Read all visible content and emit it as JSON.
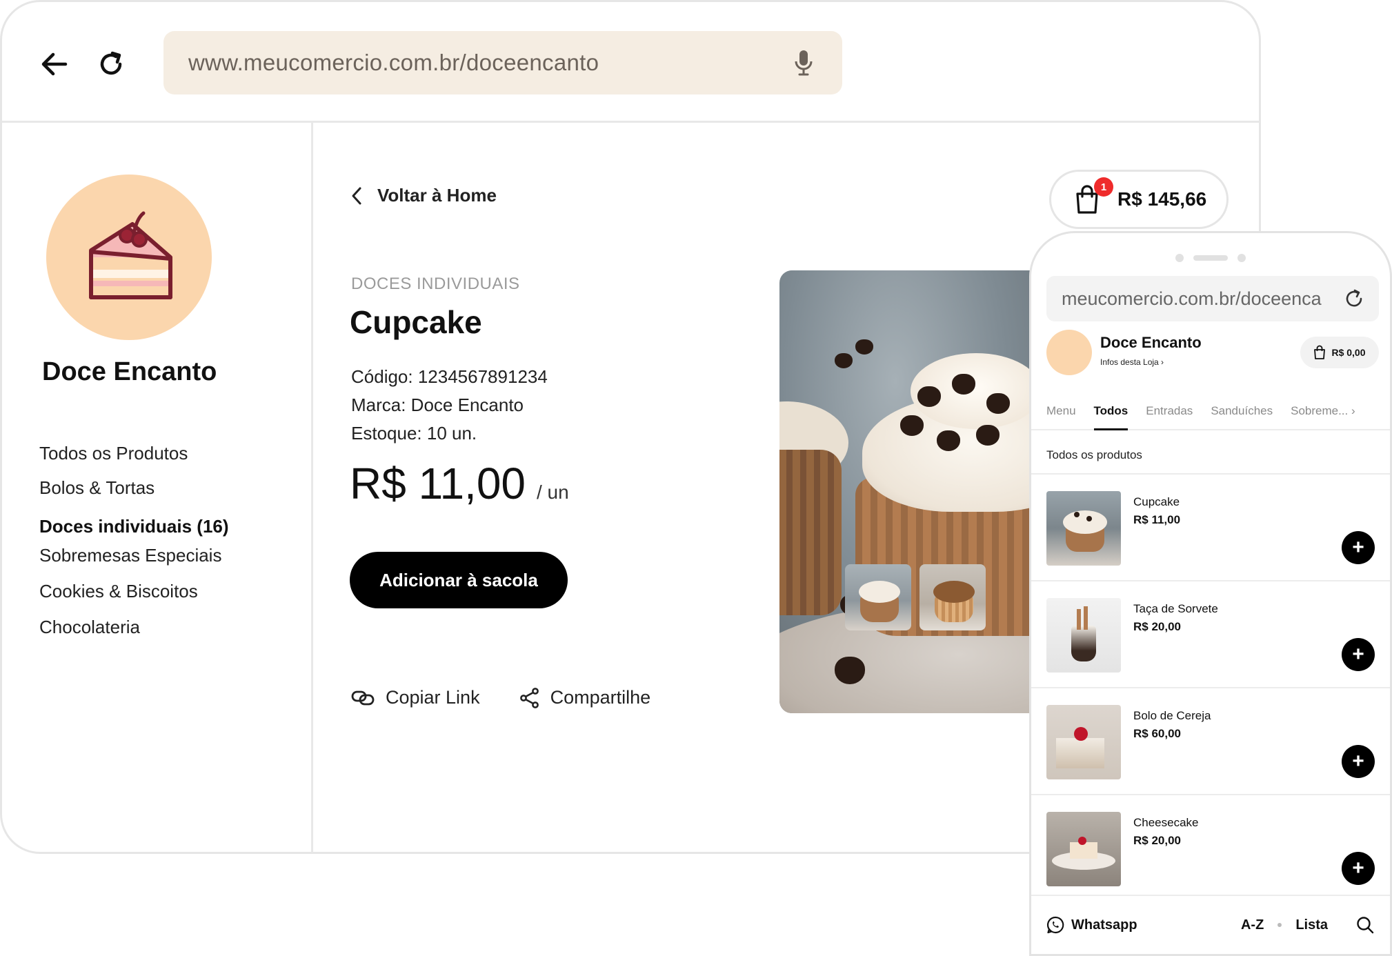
{
  "browser": {
    "url": "www.meucomercio.com.br/doceencanto",
    "back_icon": "arrow-left-icon",
    "reload_icon": "reload-icon",
    "mic_icon": "microphone-icon"
  },
  "sidebar": {
    "store_name": "Doce Encanto",
    "logo_icon": "cake-slice-icon",
    "items": [
      {
        "label": "Todos os Produtos",
        "active": false
      },
      {
        "label": "Bolos & Tortas",
        "active": false
      },
      {
        "label": "Doces individuais (16)",
        "active": true
      },
      {
        "label": "Sobremesas Especiais",
        "active": false
      },
      {
        "label": "Cookies & Biscoitos",
        "active": false
      },
      {
        "label": "Chocolateria",
        "active": false
      }
    ]
  },
  "product": {
    "back_label": "Voltar à Home",
    "cart_count": "1",
    "cart_total": "R$ 145,66",
    "category": "DOCES INDIVIDUAIS",
    "title": "Cupcake",
    "code": "Código: 1234567891234",
    "brand": "Marca: Doce Encanto",
    "stock": "Estoque: 10 un.",
    "price": "R$ 11,00",
    "unit": "/ un",
    "add_label": "Adicionar à sacola",
    "copy_link_label": "Copiar Link",
    "share_label": "Compartilhe"
  },
  "phone": {
    "url": "meucomercio.com.br/doceenca",
    "store_name": "Doce Encanto",
    "info_label": "Infos desta Loja ›",
    "cart_total": "R$ 0,00",
    "tabs": [
      {
        "label": "Menu",
        "active": false
      },
      {
        "label": "Todos",
        "active": true
      },
      {
        "label": "Entradas",
        "active": false
      },
      {
        "label": "Sanduíches",
        "active": false
      },
      {
        "label": "Sobreme... ›",
        "active": false
      }
    ],
    "section_title": "Todos os produtos",
    "items": [
      {
        "name": "Cupcake",
        "price": "R$ 11,00"
      },
      {
        "name": "Taça de Sorvete",
        "price": "R$ 20,00"
      },
      {
        "name": "Bolo de Cereja",
        "price": "R$ 60,00"
      },
      {
        "name": "Cheesecake",
        "price": "R$ 20,00"
      }
    ],
    "bottom": {
      "whatsapp_label": "Whatsapp",
      "sort_label": "A-Z",
      "view_label": "Lista"
    }
  },
  "colors": {
    "accent_peach": "#fbd6ad",
    "address_bar": "#f5ede2",
    "badge_red": "#ef2b2b",
    "button_black": "#000000"
  }
}
